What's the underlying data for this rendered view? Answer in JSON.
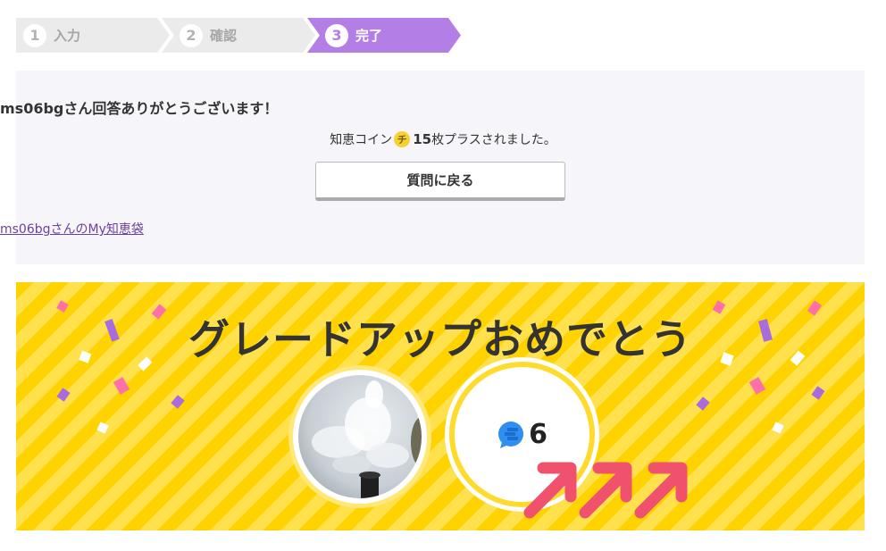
{
  "steps": [
    {
      "num": "1",
      "label": "入力"
    },
    {
      "num": "2",
      "label": "確認"
    },
    {
      "num": "3",
      "label": "完了"
    }
  ],
  "completion": {
    "thanks": "ms06bgさん回答ありがとうございます！",
    "coin_prefix": "知恵コイン",
    "coin_icon": "チ",
    "coin_amount": "15",
    "coin_suffix": "枚プラスされました。",
    "back_button": "質問に戻る",
    "my_link": "ms06bgさんのMy知恵袋"
  },
  "banner": {
    "title": "グレードアップおめでとう",
    "grade": "6",
    "colors": {
      "stripe_a": "#ffd300",
      "stripe_b": "#ffe14d",
      "arrow": "#f0526e",
      "badge": "#2f8ef0"
    }
  },
  "colors": {
    "step_active": "#b37ee6",
    "step_inactive": "#ebebeb",
    "box_bg": "#f6f6fa",
    "link": "#6c3fa0"
  }
}
